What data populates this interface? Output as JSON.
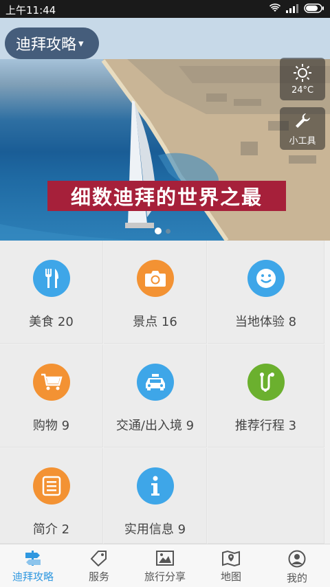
{
  "status_bar": {
    "time": "上午11:44"
  },
  "header": {
    "city_label": "迪拜攻略",
    "dropdown_arrow": "▾"
  },
  "weather": {
    "temp": "24°C",
    "icon": "sun-icon"
  },
  "tools": {
    "label": "小工具",
    "icon": "wrench-icon"
  },
  "banner": {
    "text": "细数迪拜的世界之最"
  },
  "carousel": {
    "active_index": 0,
    "count": 2
  },
  "grid": [
    {
      "label": "美食 20",
      "color": "#3ea6e8",
      "icon": "fork-knife-icon"
    },
    {
      "label": "景点 16",
      "color": "#f39233",
      "icon": "camera-icon"
    },
    {
      "label": "当地体验 8",
      "color": "#3ea6e8",
      "icon": "smiley-icon"
    },
    {
      "label": "购物 9",
      "color": "#f39233",
      "icon": "cart-icon"
    },
    {
      "label": "交通/出入境 9",
      "color": "#3ea6e8",
      "icon": "taxi-icon"
    },
    {
      "label": "推荐行程 3",
      "color": "#6bb02e",
      "icon": "route-icon"
    },
    {
      "label": "简介 2",
      "color": "#f39233",
      "icon": "document-icon"
    },
    {
      "label": "实用信息 9",
      "color": "#3ea6e8",
      "icon": "info-icon"
    }
  ],
  "bottom_nav": [
    {
      "label": "迪拜攻略",
      "icon": "signpost-icon",
      "active": true
    },
    {
      "label": "服务",
      "icon": "tag-icon",
      "active": false
    },
    {
      "label": "旅行分享",
      "icon": "picture-icon",
      "active": false
    },
    {
      "label": "地图",
      "icon": "map-icon",
      "active": false
    },
    {
      "label": "我的",
      "icon": "user-icon",
      "active": false
    }
  ],
  "colors": {
    "accent": "#2f98e0",
    "banner": "#a6203a",
    "orange": "#f39233",
    "blue": "#3ea6e8",
    "green": "#6bb02e"
  }
}
